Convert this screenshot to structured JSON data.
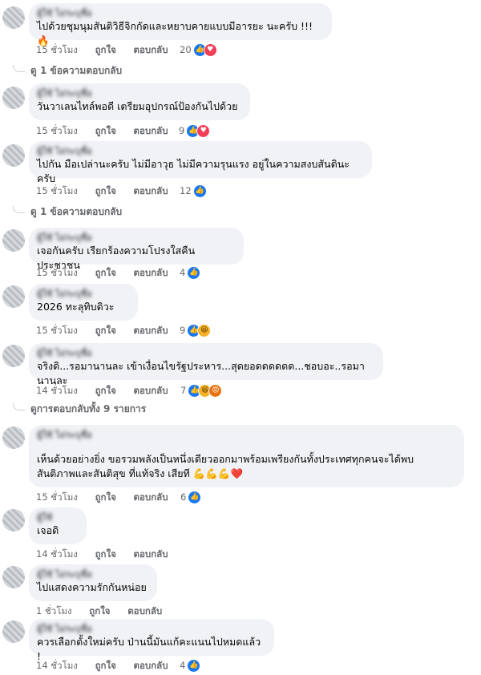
{
  "labels": {
    "like": "ถูกใจ",
    "reply": "ตอบกลับ"
  },
  "comments": [
    {
      "author": "ผู้ใช้ ไม่ระบุชื่อ",
      "text": "ไปด้วยชุมนุมสันติวิธีจิกกัดและหยาบคายแบบมีอารยะ นะครับ !!! 🔥",
      "time": "15 ชั่วโมง",
      "react_count": "20",
      "reactions": [
        "like",
        "love"
      ],
      "replies": "ดู 1 ข้อความตอบกลับ"
    },
    {
      "author": "ผู้ใช้ ไม่ระบุชื่อ",
      "text": "วันวาเลนไทล์พอดี เตรียมอุปกรณ์ป้องกันไปด้วย",
      "time": "15 ชั่วโมง",
      "react_count": "9",
      "reactions": [
        "like",
        "love"
      ]
    },
    {
      "author": "ผู้ใช้ ไม่ระบุชื่อ",
      "text": "ไปกัน มือเปล่านะครับ ไม่มีอาวุธ ไม่มีความรุนแรง อยู่ในความสงบสันตินะครับ",
      "time": "15 ชั่วโมง",
      "react_count": "12",
      "reactions": [
        "like"
      ],
      "replies": "ดู 1 ข้อความตอบกลับ"
    },
    {
      "author": "ผู้ใช้ ไม่ระบุชื่อ",
      "text": "เจอกันครับ เรียกร้องความโปรงใสคืนประชาชน",
      "time": "15 ชั่วโมง",
      "react_count": "4",
      "reactions": [
        "like"
      ]
    },
    {
      "author": "ผู้ใช้ ไม่ระบุชื่อ",
      "text": "2026 ทะลุทิบดิวะ",
      "time": "15 ชั่วโมง",
      "react_count": "9",
      "reactions": [
        "like",
        "haha"
      ]
    },
    {
      "author": "ผู้ใช้ ไม่ระบุชื่อ",
      "text": "จริงดิ...รอมานานละ เข้าเงื่อนไขรัฐประหาร...สุดยอดดดดดด...ชอบอะ..รอมานานละ",
      "time": "14 ชั่วโมง",
      "react_count": "7",
      "reactions": [
        "like",
        "haha",
        "angry"
      ],
      "replies": "ดูการตอบกลับทั้ง 9 รายการ"
    },
    {
      "author": "ผู้ใช้ ไม่ระบุชื่อ",
      "text_lines": [
        "เห็นด้วยอย่างยิ่ง ขอรวมพลังเป็นหนึ่งเดียวออกมาพร้อมเพรียงกันทั้งประเทศทุกคนจะได้พบ",
        "สันติภาพและสันติสุข ที่แท้จริง เสียที 💪💪💪❤️"
      ],
      "time": "15 ชั่วโมง",
      "react_count": "6",
      "reactions": [
        "like"
      ]
    },
    {
      "author": "ผู้ใช้",
      "text": "เจอดิ",
      "time": "14 ชั่วโมง"
    },
    {
      "author": "ผู้ใช้ ไม่ระบุชื่อ",
      "text": "ไปแสดงความรักกันหน่อย",
      "time": "1 ชั่วโมง"
    },
    {
      "author": "ผู้ใช้ ไม่ระบุชื่อ",
      "text": "ควรเลือกตั้งใหม่ครับ ป่านนี้มันแก้คะแนนไปหมดแล้ว !",
      "time": "14 ชั่วโมง",
      "react_count": "4",
      "reactions": [
        "like"
      ]
    }
  ]
}
